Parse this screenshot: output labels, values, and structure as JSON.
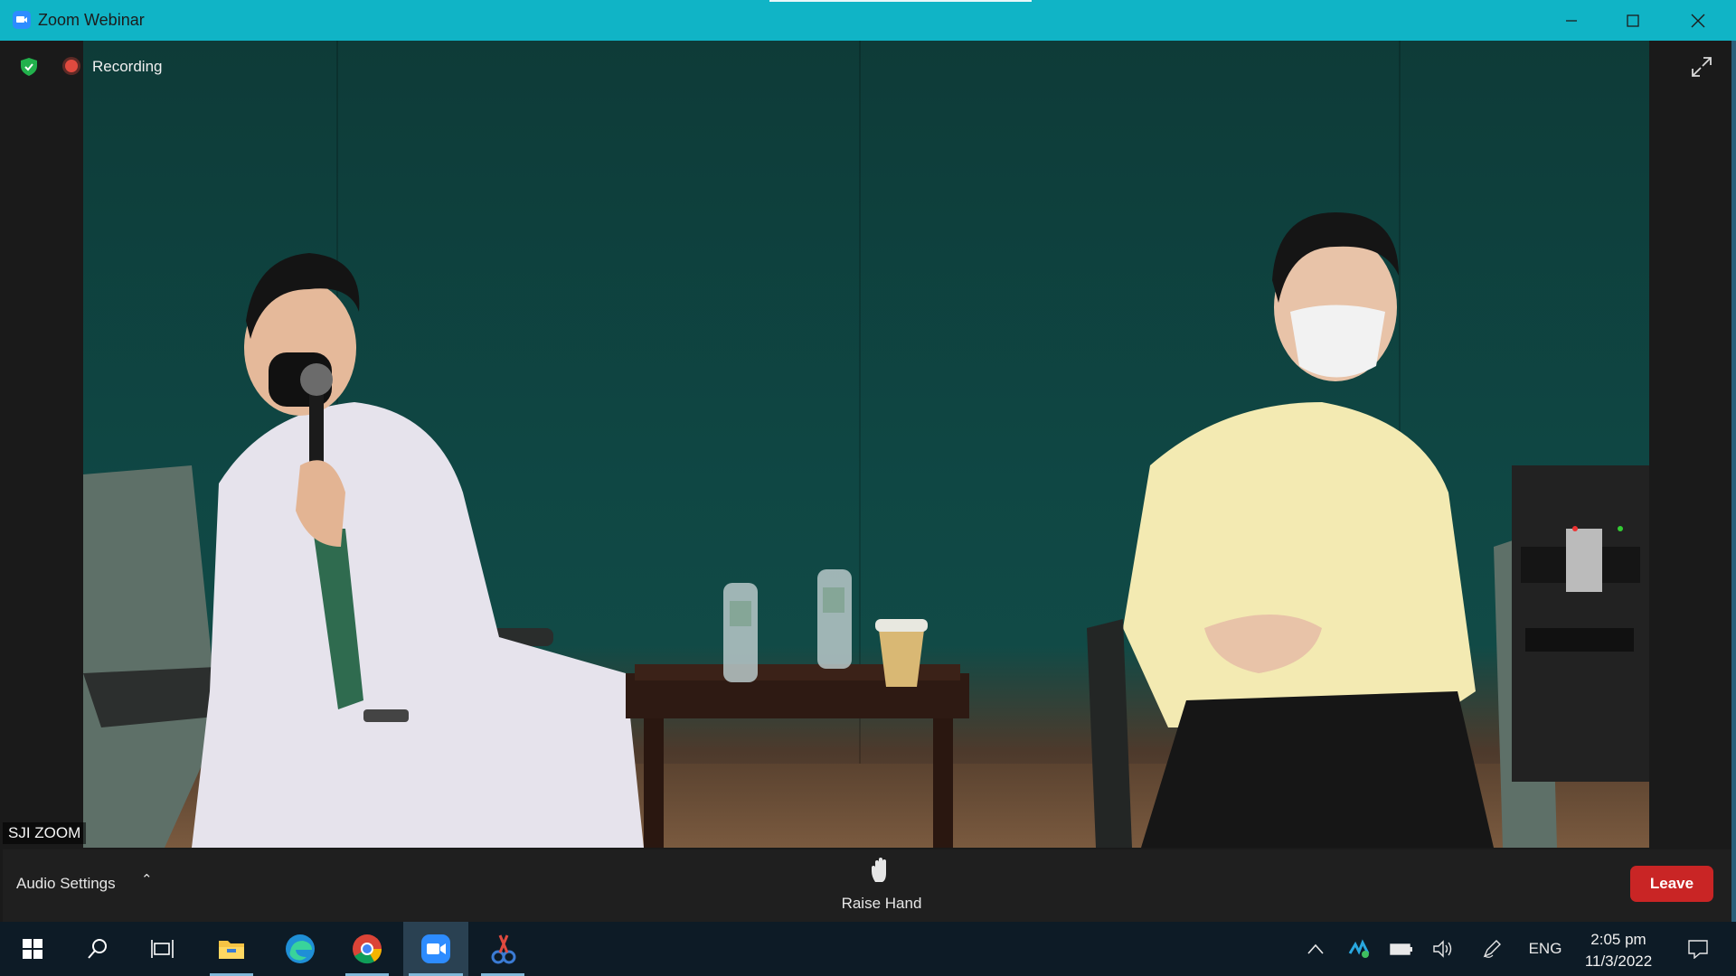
{
  "window": {
    "title": "Zoom Webinar"
  },
  "status": {
    "recording_label": "Recording"
  },
  "video": {
    "participant_name": "SJI ZOOM"
  },
  "controls": {
    "audio_settings_label": "Audio Settings",
    "raise_hand_label": "Raise Hand",
    "leave_label": "Leave"
  },
  "taskbar": {
    "language": "ENG",
    "time": "2:05 pm",
    "date": "11/3/2022",
    "apps": [
      "start-icon",
      "search-icon",
      "task-view-icon",
      "file-explorer-icon",
      "edge-icon",
      "chrome-icon",
      "zoom-icon",
      "snipping-tool-icon"
    ]
  },
  "colors": {
    "titlebar": "#10b4c6",
    "leave": "#c92525",
    "recording": "#e04a3f"
  }
}
